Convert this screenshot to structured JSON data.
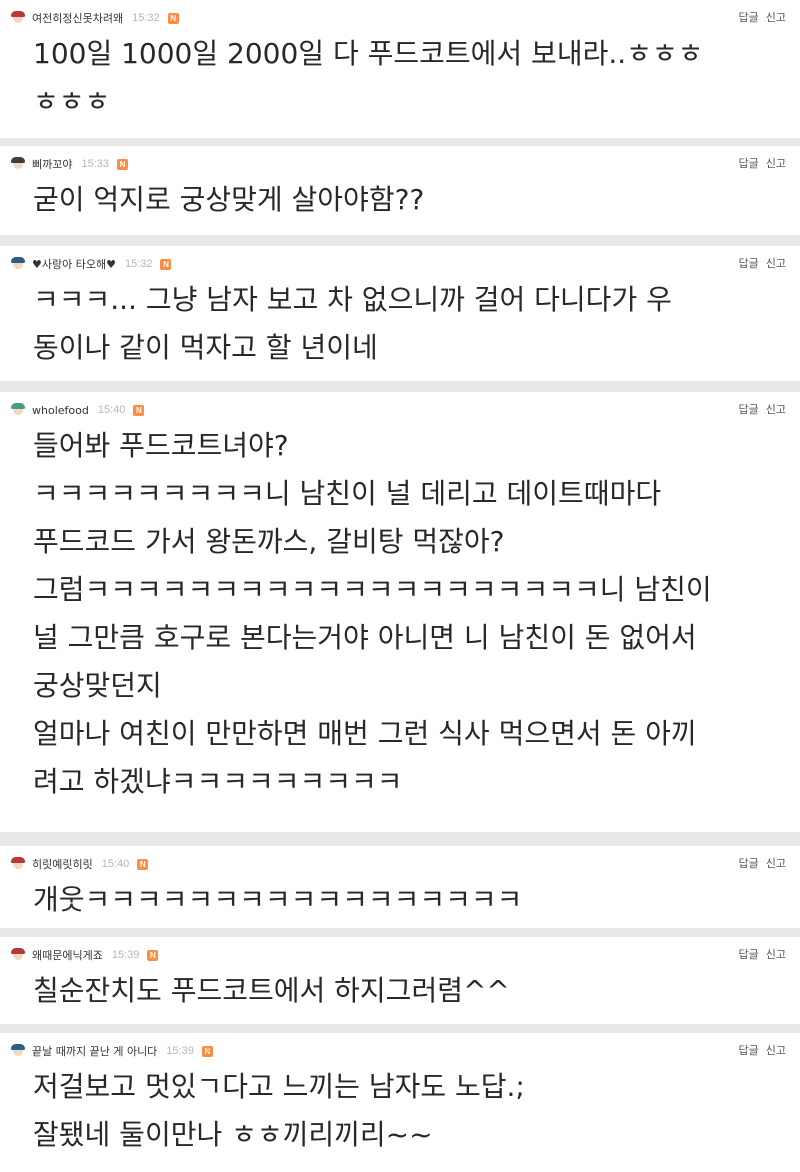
{
  "actions": {
    "reply": "답글",
    "report": "신고"
  },
  "comments": [
    {
      "nickname": "여전히정신못차려왜",
      "time": "15:32",
      "badge": "N",
      "text": "100일 1000일 2000일 다 푸드코트에서 보내라..ㅎㅎㅎ\nㅎㅎㅎ"
    },
    {
      "nickname": "삐까꼬야",
      "time": "15:33",
      "badge": "N",
      "text": "굳이 억지로 궁상맞게 살아야함??"
    },
    {
      "nickname": "♥사랑아 타오해♥",
      "time": "15:32",
      "badge": "N",
      "text": "ㅋㅋㅋ... 그냥 남자 보고 차 없으니까 걸어 다니다가 우\n동이나 같이 먹자고 할 년이네"
    },
    {
      "nickname": "wholefood",
      "time": "15:40",
      "badge": "N",
      "text": "들어봐 푸드코트녀야?\nㅋㅋㅋㅋㅋㅋㅋㅋㅋ니 남친이 널 데리고 데이트때마다\n푸드코드 가서 왕돈까스, 갈비탕 먹잖아?\n그럼ㅋㅋㅋㅋㅋㅋㅋㅋㅋㅋㅋㅋㅋㅋㅋㅋㅋㅋㅋㅋ니 남친이\n널 그만큼 호구로 본다는거야 아니면 니 남친이 돈 없어서\n궁상맞던지\n얼마나 여친이 만만하면 매번 그런 식사 먹으면서 돈 아끼\n려고 하겠냐ㅋㅋㅋㅋㅋㅋㅋㅋㅋ"
    },
    {
      "nickname": "히릿예릿히릿",
      "time": "15:40",
      "badge": "N",
      "text": "개웃ㅋㅋㅋㅋㅋㅋㅋㅋㅋㅋㅋㅋㅋㅋㅋㅋㅋ"
    },
    {
      "nickname": "왜때문에닉게죠",
      "time": "15:39",
      "badge": "N",
      "text": "칠순잔치도 푸드코트에서 하지그러렴^^"
    },
    {
      "nickname": "끝날 때까지 끝난 게 아니다",
      "time": "15:39",
      "badge": "N",
      "text": "저걸보고 멋있ㄱ다고 느끼는 남자도 노답.;\n잘됐네 둘이만나 ㅎㅎ끼리끼리~~"
    }
  ]
}
